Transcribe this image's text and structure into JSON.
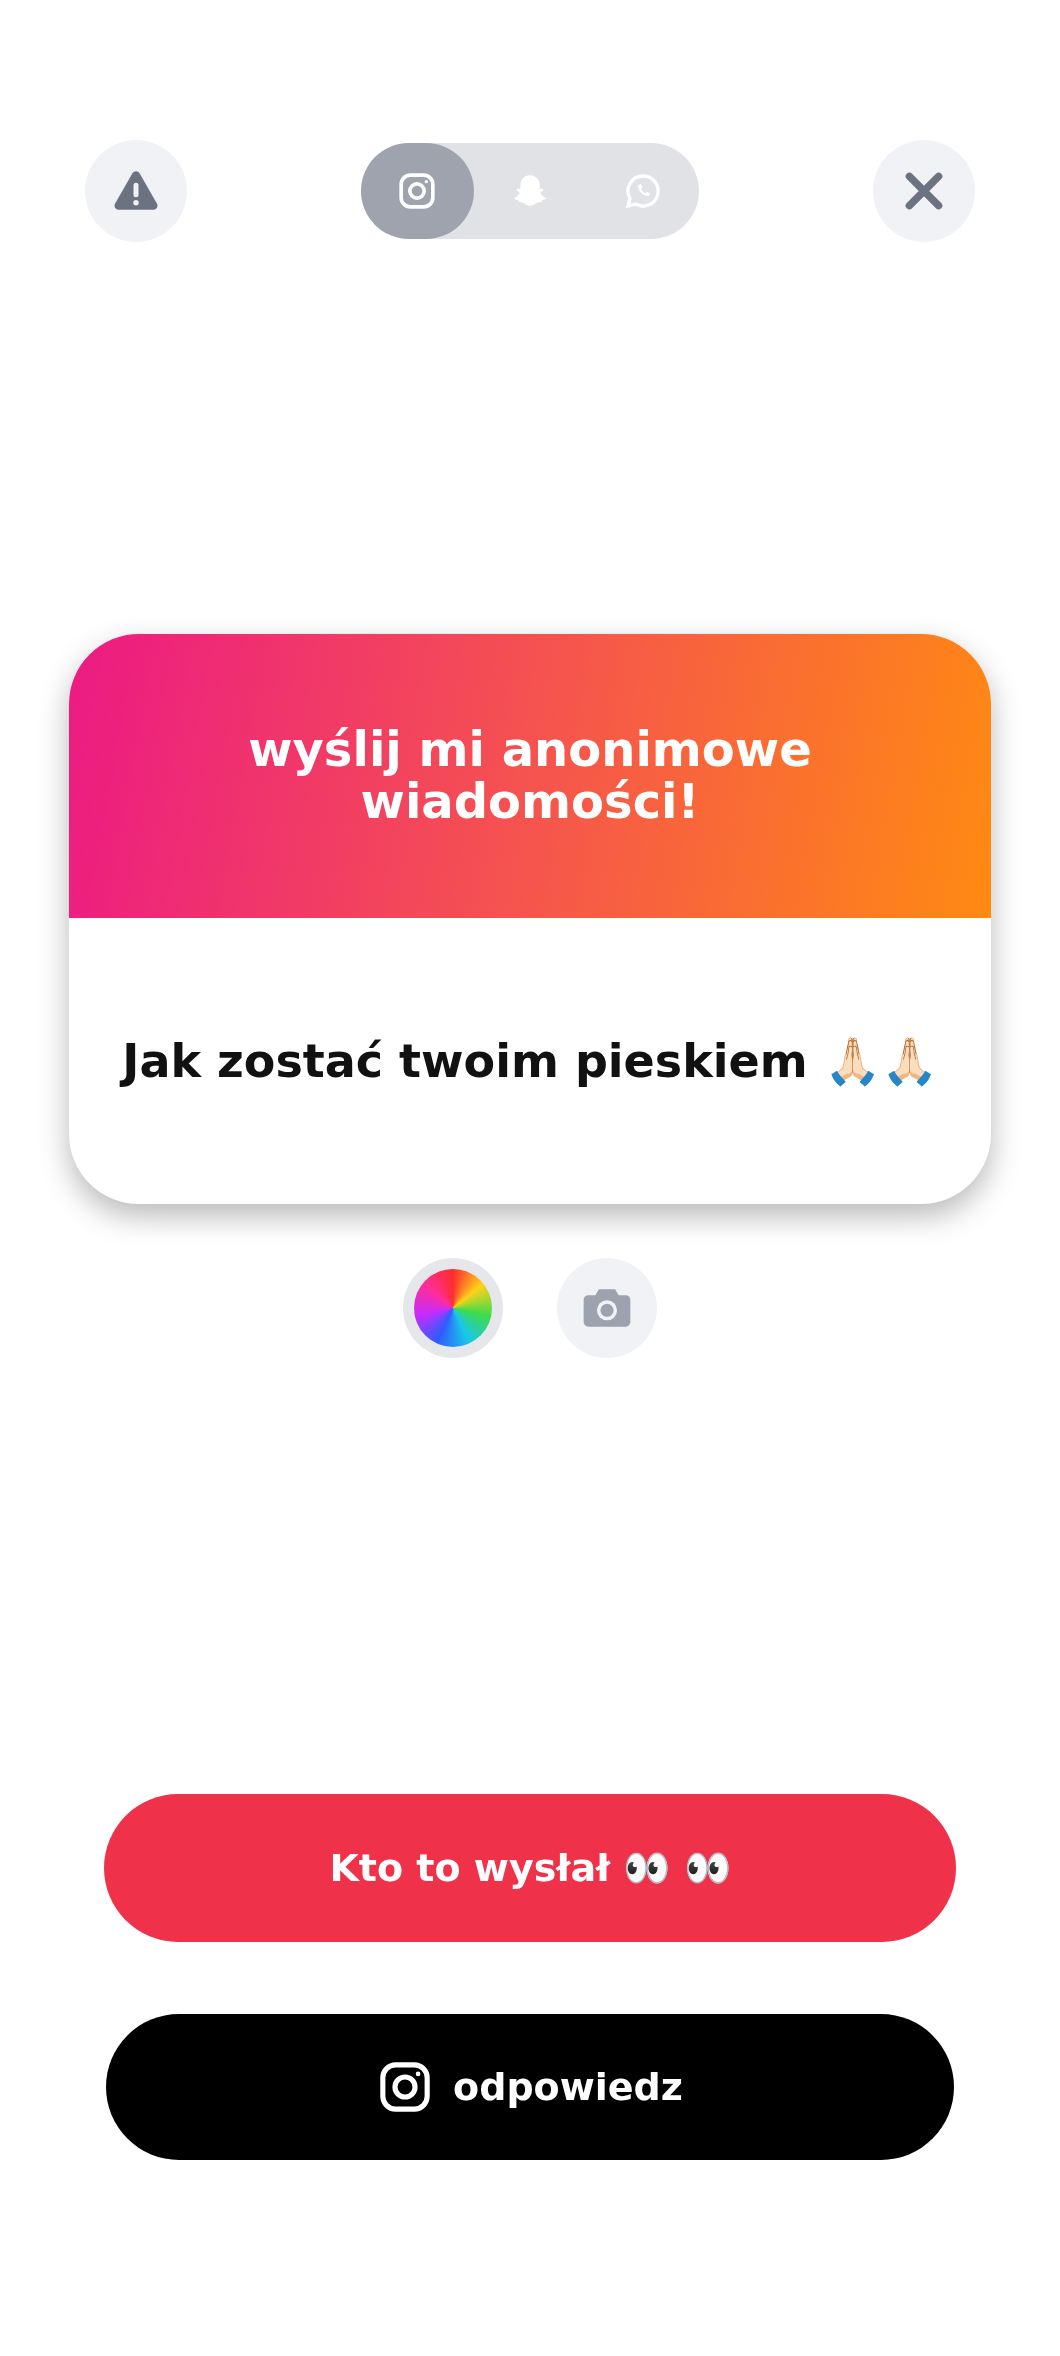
{
  "share_targets": [
    {
      "kind": "instagram",
      "selected": true
    },
    {
      "kind": "snapchat",
      "selected": false
    },
    {
      "kind": "whatsapp",
      "selected": false
    }
  ],
  "card": {
    "title": "wyślij mi anonimowe wiadomości!",
    "message": "Jak zostać twoim pieskiem 🙏🏻🙏🏻"
  },
  "buttons": [
    {
      "kind": "primary",
      "label": "Kto to wysłał 👀 👀"
    },
    {
      "kind": "instagram",
      "label": "odpowiedz"
    }
  ]
}
